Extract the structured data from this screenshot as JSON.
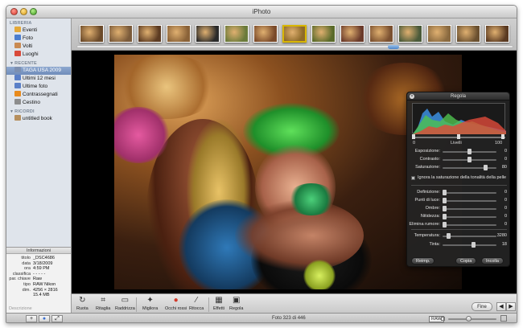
{
  "window": {
    "title": "iPhoto"
  },
  "sidebar": {
    "sections": [
      {
        "label": "LIBRERIA",
        "items": [
          {
            "label": "Eventi",
            "icon": "events-icon",
            "color": "#e4a93a"
          },
          {
            "label": "Foto",
            "icon": "photos-icon",
            "color": "#4c7ecf"
          },
          {
            "label": "Volti",
            "icon": "faces-icon",
            "color": "#c98a52"
          },
          {
            "label": "Luoghi",
            "icon": "places-icon",
            "color": "#d94a3a"
          }
        ]
      },
      {
        "label": "RECENTE",
        "items": [
          {
            "label": "TAGA USA 2009",
            "icon": "event-icon",
            "color": "#7c8fb0",
            "selected": true
          },
          {
            "label": "Ultimi 12 mesi",
            "icon": "calendar-icon",
            "color": "#5a7fc7"
          },
          {
            "label": "Ultime foto",
            "icon": "import-icon",
            "color": "#5a7fc7"
          },
          {
            "label": "Contrassegnati",
            "icon": "flag-icon",
            "color": "#e88a1c"
          },
          {
            "label": "Cestino",
            "icon": "trash-icon",
            "color": "#8d8d8d"
          }
        ]
      },
      {
        "label": "RICORDI",
        "items": [
          {
            "label": "untitled book",
            "icon": "book-icon",
            "color": "#b68f5e"
          }
        ]
      }
    ]
  },
  "info": {
    "header": "Informazioni",
    "rows": [
      {
        "k": "titolo",
        "v": "_DSC4686"
      },
      {
        "k": "data",
        "v": "3/18/2009"
      },
      {
        "k": "ora",
        "v": "4:59 PM"
      },
      {
        "k": "classifica",
        "v": "- - - - -"
      },
      {
        "k": "par. chiave",
        "v": "Raw"
      },
      {
        "k": "tipo",
        "v": "RAW Nikon"
      },
      {
        "k": "dim.",
        "v": "4256 × 2816"
      },
      {
        "k": "",
        "v": "15.4 MB"
      }
    ],
    "description_placeholder": "Descrizione"
  },
  "filmstrip": {
    "thumbs": [
      {
        "color": "#6b4a2a",
        "selected": false
      },
      {
        "color": "#7a5a3a",
        "selected": false
      },
      {
        "color": "#5c3b22",
        "selected": false
      },
      {
        "color": "#8a6238",
        "selected": false
      },
      {
        "color": "#2a2a2a",
        "selected": false
      },
      {
        "color": "#6a7a3a",
        "selected": false
      },
      {
        "color": "#7a4a2a",
        "selected": false
      },
      {
        "color": "#8e6a2a",
        "selected": true
      },
      {
        "color": "#5a6a2a",
        "selected": false
      },
      {
        "color": "#6a3a2a",
        "selected": false
      },
      {
        "color": "#7a5030",
        "selected": false
      },
      {
        "color": "#4a5a3a",
        "selected": false
      },
      {
        "color": "#8a6a40",
        "selected": false
      },
      {
        "color": "#6a5030",
        "selected": false
      },
      {
        "color": "#5a3a22",
        "selected": false
      }
    ]
  },
  "adjust": {
    "title": "Regola",
    "levels": {
      "label": "Livelli",
      "min": "0",
      "max": "100"
    },
    "sliders_top": [
      {
        "label": "Esposizione:",
        "value": "0",
        "pos": 0.5
      },
      {
        "label": "Contrasto:",
        "value": "0",
        "pos": 0.5
      },
      {
        "label": "Saturazione:",
        "value": "80",
        "pos": 0.82
      }
    ],
    "checkbox_label": "Ignora la saturazione della tonalità della pelle",
    "sliders_mid": [
      {
        "label": "Definizione:",
        "value": "0",
        "pos": 0.0
      },
      {
        "label": "Punti di luce:",
        "value": "0",
        "pos": 0.0
      },
      {
        "label": "Ombre:",
        "value": "0",
        "pos": 0.0
      },
      {
        "label": "Nitidezza:",
        "value": "0",
        "pos": 0.0
      },
      {
        "label": "Elimina rumore:",
        "value": "0",
        "pos": 0.0
      }
    ],
    "sliders_bottom": [
      {
        "label": "Temperatura:",
        "value": "3280",
        "pos": 0.08
      },
      {
        "label": "Tinta:",
        "value": "18",
        "pos": 0.58
      }
    ],
    "buttons": {
      "reset": "Reimp.",
      "copy": "Copia",
      "paste": "Incolla"
    }
  },
  "toolbar": {
    "buttons": [
      {
        "label": "Ruota",
        "icon": "rotate-icon",
        "glyph": "↻"
      },
      {
        "label": "Ritaglia",
        "icon": "crop-icon",
        "glyph": "⌗"
      },
      {
        "label": "Raddrizza",
        "icon": "straighten-icon",
        "glyph": "▭"
      },
      {
        "label": "Migliora",
        "icon": "enhance-wand-icon",
        "glyph": "✦"
      },
      {
        "label": "Occhi rossi",
        "icon": "red-eye-icon",
        "glyph": "●"
      },
      {
        "label": "Ritocca",
        "icon": "retouch-icon",
        "glyph": "⁄"
      },
      {
        "label": "Effetti",
        "icon": "effects-icon",
        "glyph": "▦"
      },
      {
        "label": "Regola",
        "icon": "adjust-icon",
        "glyph": "▣"
      }
    ],
    "done": "Fine"
  },
  "status": {
    "text": "Foto 323 di 446",
    "raw": "RAW"
  }
}
